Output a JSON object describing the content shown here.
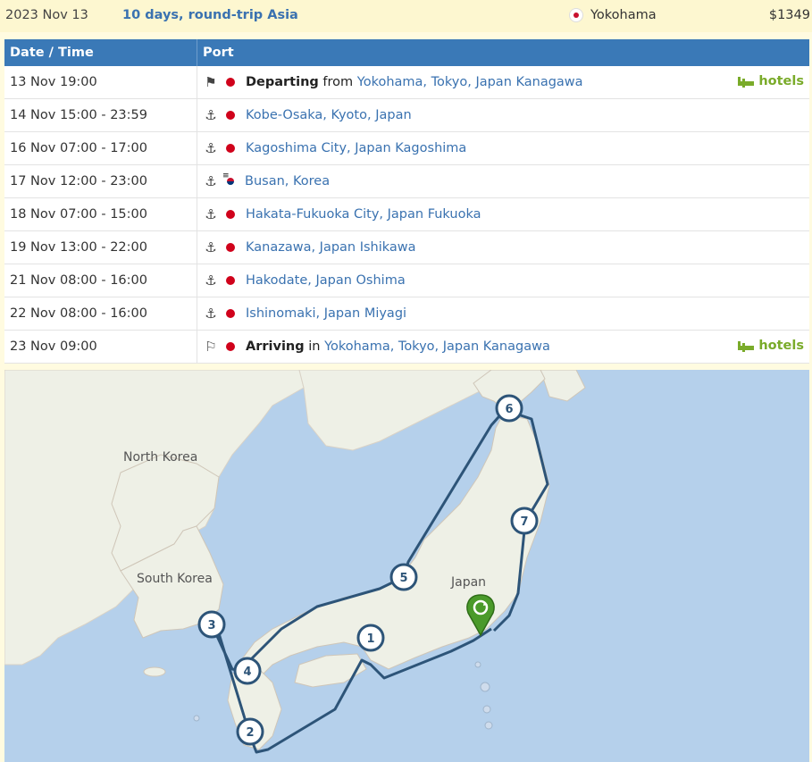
{
  "header": {
    "date": "2023 Nov 13",
    "trip": "10 days, round-trip Asia",
    "port": "Yokohama",
    "price": "$1349"
  },
  "table": {
    "col_date": "Date / Time",
    "col_port": "Port"
  },
  "rows": [
    {
      "datetime": "13 Nov 19:00",
      "icon": "departure-flag-icon",
      "flag": "jp",
      "prefix": "Departing",
      "mid": "from",
      "place": "Yokohama, Tokyo, Japan Kanagawa",
      "hotels": "hotels"
    },
    {
      "datetime": "14 Nov 15:00 - 23:59",
      "icon": "anchor-icon",
      "flag": "jp",
      "place": "Kobe-Osaka, Kyoto, Japan"
    },
    {
      "datetime": "16 Nov 07:00 - 17:00",
      "icon": "anchor-icon",
      "flag": "jp",
      "place": "Kagoshima City, Japan Kagoshima"
    },
    {
      "datetime": "17 Nov 12:00 - 23:00",
      "icon": "anchor-icon",
      "flag": "kr",
      "place": "Busan, Korea"
    },
    {
      "datetime": "18 Nov 07:00 - 15:00",
      "icon": "anchor-icon",
      "flag": "jp",
      "place": "Hakata-Fukuoka City, Japan Fukuoka"
    },
    {
      "datetime": "19 Nov 13:00 - 22:00",
      "icon": "anchor-icon",
      "flag": "jp",
      "place": "Kanazawa, Japan Ishikawa"
    },
    {
      "datetime": "21 Nov 08:00 - 16:00",
      "icon": "anchor-icon",
      "flag": "jp",
      "place": "Hakodate, Japan Oshima"
    },
    {
      "datetime": "22 Nov 08:00 - 16:00",
      "icon": "anchor-icon",
      "flag": "jp",
      "place": "Ishinomaki, Japan Miyagi"
    },
    {
      "datetime": "23 Nov 09:00",
      "icon": "arrival-flag-icon",
      "flag": "jp",
      "prefix": "Arriving",
      "mid": "in",
      "place": "Yokohama, Tokyo, Japan Kanagawa",
      "hotels": "hotels"
    }
  ],
  "map": {
    "labels": {
      "north_korea": "North Korea",
      "south_korea": "South Korea",
      "japan": "Japan"
    },
    "markers": [
      "1",
      "2",
      "3",
      "4",
      "5",
      "6",
      "7"
    ],
    "colors": {
      "route": "#2d5478",
      "sea": "#b5d0eb",
      "land": "#eef0e6",
      "pin": "#4a9a2a"
    }
  }
}
